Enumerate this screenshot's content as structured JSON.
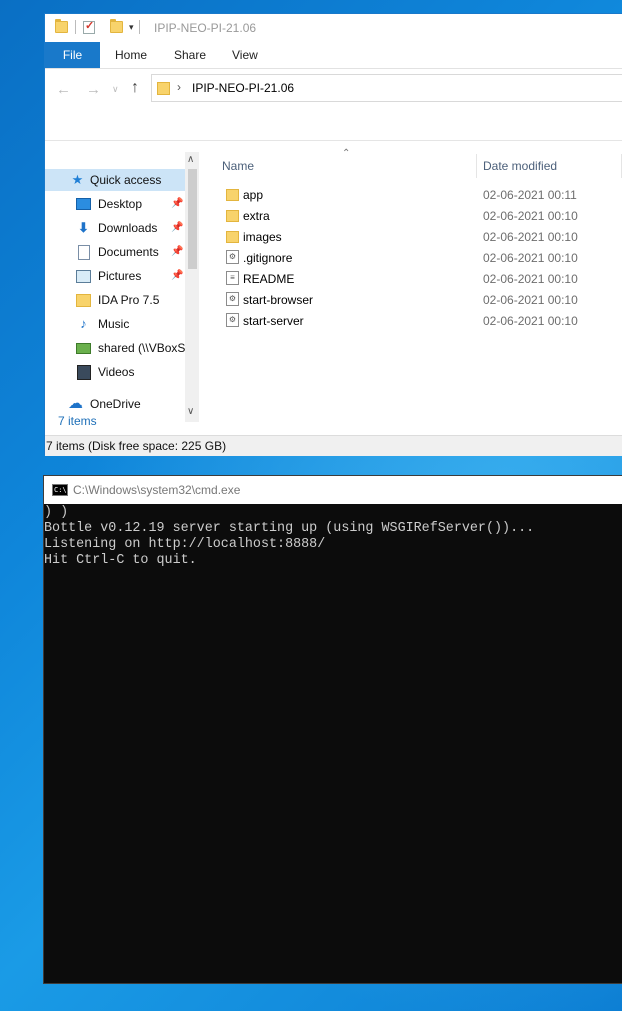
{
  "explorer": {
    "title": "IPIP-NEO-PI-21.06",
    "tabs": [
      "File",
      "Home",
      "Share",
      "View"
    ],
    "address": "IPIP-NEO-PI-21.06",
    "nav_items": [
      {
        "label": "Quick access",
        "icon": "star-icon"
      },
      {
        "label": "Desktop",
        "icon": "desktop-icon",
        "pinned": true
      },
      {
        "label": "Downloads",
        "icon": "download-icon",
        "pinned": true
      },
      {
        "label": "Documents",
        "icon": "documents-icon",
        "pinned": true
      },
      {
        "label": "Pictures",
        "icon": "pictures-icon",
        "pinned": true
      },
      {
        "label": "IDA Pro 7.5",
        "icon": "folder-icon"
      },
      {
        "label": "Music",
        "icon": "music-icon"
      },
      {
        "label": "shared (\\\\VBoxS",
        "icon": "network-drive-icon"
      },
      {
        "label": "Videos",
        "icon": "videos-icon"
      },
      {
        "label": "OneDrive",
        "icon": "cloud-icon"
      }
    ],
    "item_count": "7 items",
    "columns": {
      "name": "Name",
      "date": "Date modified"
    },
    "files": [
      {
        "name": "app",
        "date": "02-06-2021 00:11",
        "type": "folder"
      },
      {
        "name": "extra",
        "date": "02-06-2021 00:10",
        "type": "folder"
      },
      {
        "name": "images",
        "date": "02-06-2021 00:10",
        "type": "folder"
      },
      {
        "name": ".gitignore",
        "date": "02-06-2021 00:10",
        "type": "file"
      },
      {
        "name": "README",
        "date": "02-06-2021 00:10",
        "type": "file"
      },
      {
        "name": "start-browser",
        "date": "02-06-2021 00:10",
        "type": "script"
      },
      {
        "name": "start-server",
        "date": "02-06-2021 00:10",
        "type": "script"
      }
    ],
    "status_text": "7 items (Disk free space: 225 GB)"
  },
  "cmd": {
    "title": "C:\\Windows\\system32\\cmd.exe",
    "icon_text": "C:\\",
    "lines": [
      ") )",
      "Bottle v0.12.19 server starting up (using WSGIRefServer())...",
      "Listening on http://localhost:8888/",
      "Hit Ctrl-C to quit."
    ]
  },
  "colors": {
    "accent": "#1979ca",
    "selection": "#cce4f7",
    "console_bg": "#0c0c0c",
    "console_fg": "#cccccc"
  }
}
